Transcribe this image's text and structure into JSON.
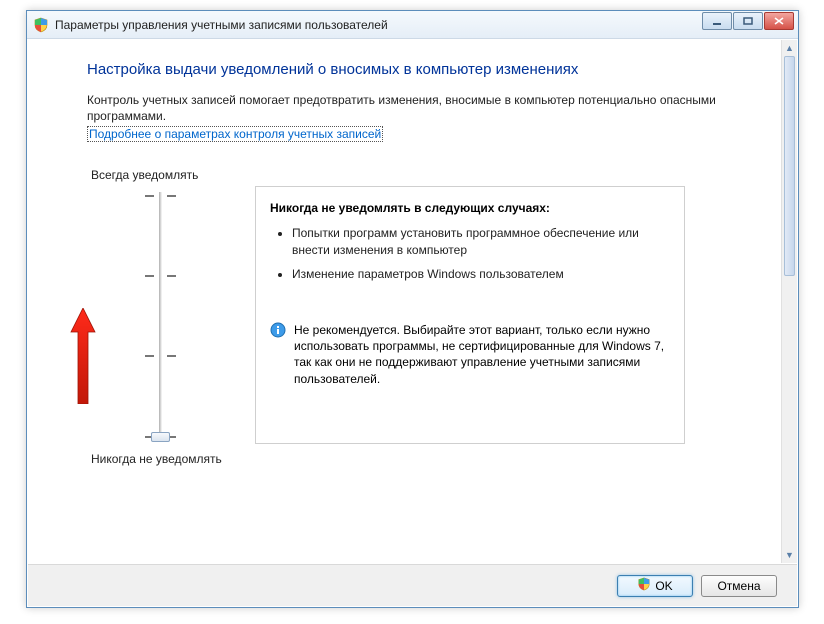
{
  "window": {
    "title": "Параметры управления учетными записями пользователей"
  },
  "page": {
    "heading": "Настройка выдачи уведомлений о вносимых в компьютер изменениях",
    "intro": "Контроль учетных записей помогает предотвратить изменения, вносимые в компьютер потенциально опасными программами.",
    "learn_more": "Подробнее о параметрах контроля учетных записей"
  },
  "slider": {
    "top_label": "Всегда уведомлять",
    "bottom_label": "Никогда не уведомлять",
    "position": 0
  },
  "panel": {
    "title": "Никогда не уведомлять в следующих случаях:",
    "bullets": [
      "Попытки программ установить программное обеспечение или внести изменения в компьютер",
      "Изменение параметров Windows пользователем"
    ],
    "note": "Не рекомендуется. Выбирайте этот вариант, только если нужно использовать программы, не сертифицированные для Windows 7, так как они не поддерживают управление учетными записями пользователей."
  },
  "footer": {
    "ok": "OK",
    "cancel": "Отмена"
  }
}
